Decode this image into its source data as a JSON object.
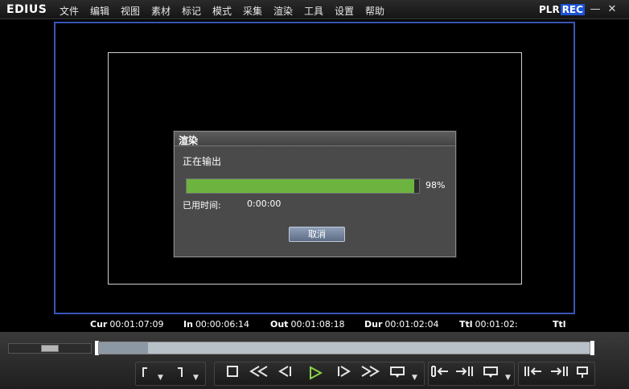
{
  "app": {
    "brand": "EDIUS"
  },
  "menu": [
    "文件",
    "编辑",
    "视图",
    "素材",
    "标记",
    "模式",
    "采集",
    "渲染",
    "工具",
    "设置",
    "帮助"
  ],
  "mode": {
    "plr": "PLR",
    "rec": "REC"
  },
  "window_buttons": {
    "minimize": "—",
    "close": "✕"
  },
  "timecodes": {
    "cur": {
      "label": "Cur",
      "value": "00:01:07:09"
    },
    "in": {
      "label": "In",
      "value": "00:00:06:14"
    },
    "out": {
      "label": "Out",
      "value": "00:01:08:18"
    },
    "dur": {
      "label": "Dur",
      "value": "00:01:02:04"
    },
    "ttl": {
      "label": "Ttl",
      "value": "00:01:02:"
    },
    "ttl2": {
      "label": "Ttl",
      "value": ""
    }
  },
  "dialog": {
    "title": "渲染",
    "status": "正在输出",
    "progress_percent": 98,
    "progress_label": "98%",
    "elapsed_label": "已用时间:",
    "elapsed_value": "0:00:00",
    "cancel_label": "取消"
  },
  "timeline": {
    "scrub_position_fraction": 0.1
  },
  "colors": {
    "progress": "#6db33f",
    "safe_outer": "#3954b8",
    "rec_badge": "#1c53d6"
  }
}
